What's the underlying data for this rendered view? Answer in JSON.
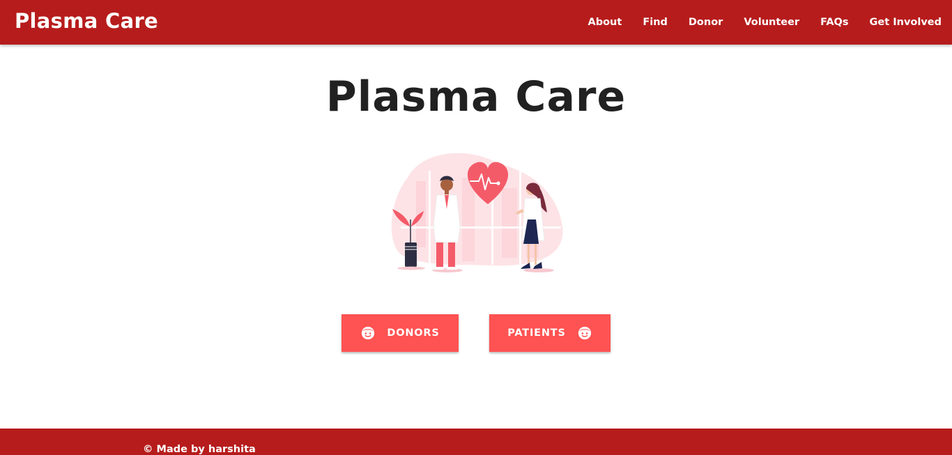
{
  "navbar": {
    "brand": "Plasma Care",
    "links": [
      "About",
      "Find",
      "Donor",
      "Volunteer",
      "FAQs",
      "Get Involved"
    ]
  },
  "hero": {
    "title": "Plasma Care"
  },
  "buttons": {
    "donors_label": "DONORS",
    "patients_label": "PATIENTS"
  },
  "footer": {
    "text": "© Made by harshita"
  },
  "colors": {
    "nav_bg": "#b71c1c",
    "button_bg": "#ff5252",
    "title_text": "#212121"
  },
  "icons": {
    "button_icon": "face-icon",
    "illustration": "doctors-heart-illustration"
  }
}
